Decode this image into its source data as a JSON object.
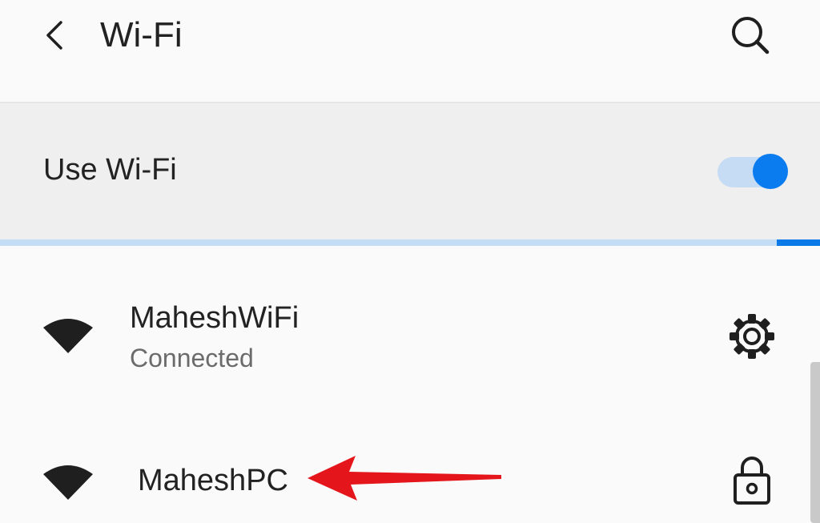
{
  "appbar": {
    "title": "Wi-Fi",
    "back_icon": "chevron-left-icon",
    "search_icon": "search-icon"
  },
  "wifi_toggle": {
    "label": "Use Wi-Fi",
    "state": "on"
  },
  "scan_progress": {
    "fraction": 0.947
  },
  "networks": [
    {
      "name": "MaheshWiFi",
      "status": "Connected",
      "signal_icon": "wifi-signal-icon",
      "action_icon": "gear-icon"
    },
    {
      "name": "MaheshPC",
      "signal_icon": "wifi-signal-icon",
      "trailing_icon": "lock-icon"
    }
  ],
  "annotation": {
    "icon": "red-arrow-icon"
  },
  "colors": {
    "accent": "#0a7cf0",
    "switch_track": "#c6dbf4",
    "progress_track": "#c4dcf6",
    "progress_fill": "#0b7ae8",
    "annotation_red": "#e5161b",
    "icon_dark": "#1f1f1f"
  }
}
